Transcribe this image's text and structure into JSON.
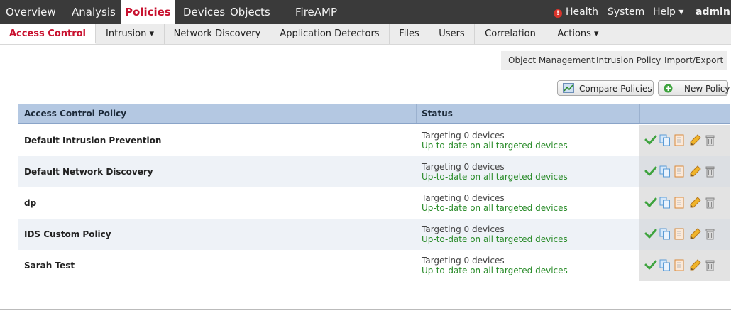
{
  "topnav": {
    "items": [
      "Overview",
      "Analysis",
      "Policies",
      "Devices",
      "Objects",
      "FireAMP"
    ],
    "active": "Policies",
    "health": "Health",
    "health_badge": "!",
    "system": "System",
    "help": "Help ▾",
    "user": "admin"
  },
  "subnav": {
    "items": [
      "Access Control",
      "Intrusion ▾",
      "Network Discovery",
      "Application Detectors",
      "Files",
      "Users",
      "Correlation",
      "Actions ▾"
    ],
    "active": "Access Control"
  },
  "utility_links": [
    "Object Management",
    "Intrusion Policy",
    "Import/Export"
  ],
  "buttons": {
    "compare": "Compare Policies",
    "new_policy": "New Policy"
  },
  "table": {
    "headers": [
      "Access Control Policy",
      "Status",
      ""
    ],
    "rows": [
      {
        "name": "Default Intrusion Prevention",
        "status_line1": "Targeting 0 devices",
        "status_line2": "Up-to-date on all targeted devices"
      },
      {
        "name": "Default Network Discovery",
        "status_line1": "Targeting 0 devices",
        "status_line2": "Up-to-date on all targeted devices"
      },
      {
        "name": "dp",
        "status_line1": "Targeting 0 devices",
        "status_line2": "Up-to-date on all targeted devices"
      },
      {
        "name": "IDS Custom Policy",
        "status_line1": "Targeting 0 devices",
        "status_line2": "Up-to-date on all targeted devices"
      },
      {
        "name": "Sarah Test",
        "status_line1": "Targeting 0 devices",
        "status_line2": "Up-to-date on all targeted devices"
      }
    ],
    "row_actions": [
      "checkmark-icon",
      "copy-icon",
      "report-icon",
      "pencil-icon",
      "trash-icon"
    ]
  },
  "colors": {
    "accent": "#c8102e",
    "topbar": "#3a3a3a",
    "header_bg": "#b4c8e2",
    "status_ok": "#2a8c2a"
  }
}
